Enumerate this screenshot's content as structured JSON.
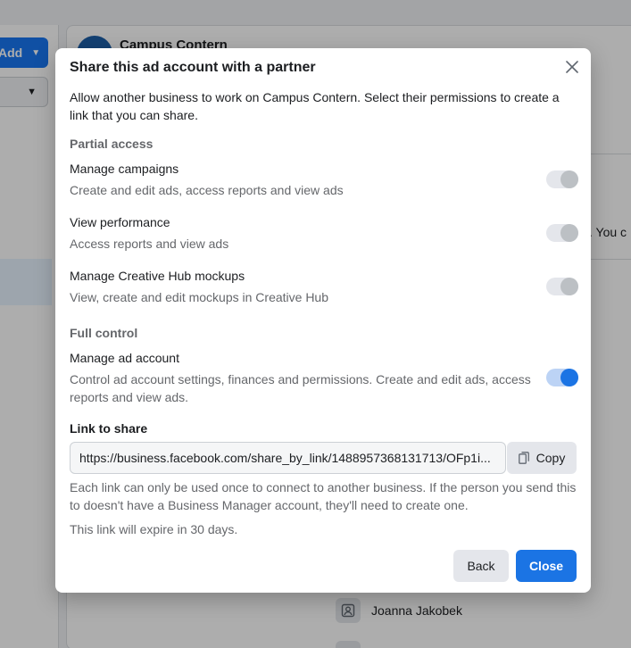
{
  "background": {
    "add_button_label": "Add",
    "account_name": "Campus Contern",
    "peek_text": ". You c",
    "person_name": "Joanna Jakobek"
  },
  "modal": {
    "title": "Share this ad account with a partner",
    "intro": "Allow another business to work on Campus Contern. Select their permissions to create a link that you can share.",
    "partial_access_label": "Partial access",
    "full_control_label": "Full control",
    "permissions": [
      {
        "name": "Manage campaigns",
        "description": "Create and edit ads, access reports and view ads",
        "enabled": false
      },
      {
        "name": "View performance",
        "description": "Access reports and view ads",
        "enabled": false
      },
      {
        "name": "Manage Creative Hub mockups",
        "description": "View, create and edit mockups in Creative Hub",
        "enabled": false
      },
      {
        "name": "Manage ad account",
        "description": "Control ad account settings, finances and permissions. Create and edit ads, access reports and view ads.",
        "enabled": true
      }
    ],
    "link_label": "Link to share",
    "link_value": "https://business.facebook.com/share_by_link/1488957368131713/OFp1i...",
    "copy_label": "Copy",
    "note_once": "Each link can only be used once to connect to another business. If the person you send this to doesn't have a Business Manager account, they'll need to create one.",
    "note_expire": "This link will expire in 30 days.",
    "back_label": "Back",
    "close_label": "Close"
  },
  "colors": {
    "primary": "#1b74e4",
    "toggle_on_track": "#bcd3f5",
    "toggle_off_knob": "#bcc0c4"
  }
}
